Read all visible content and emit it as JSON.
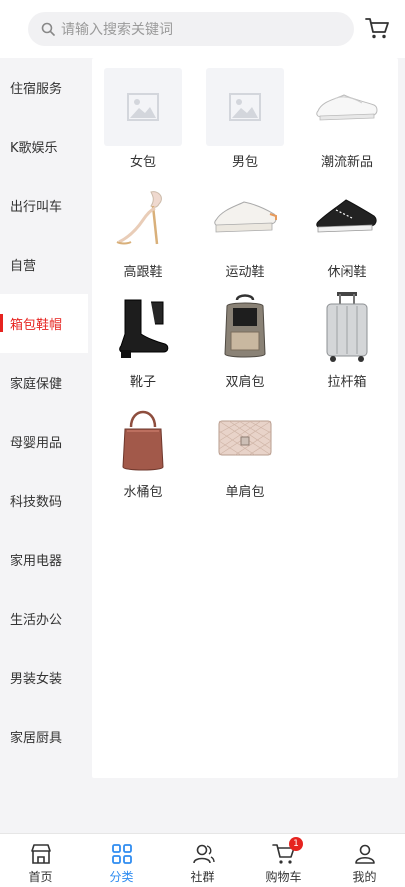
{
  "search": {
    "placeholder": "请输入搜索关键词"
  },
  "sidebar": {
    "items": [
      {
        "label": "住宿服务"
      },
      {
        "label": "K歌娱乐"
      },
      {
        "label": "出行叫车"
      },
      {
        "label": "自营"
      },
      {
        "label": "箱包鞋帽",
        "active": true
      },
      {
        "label": "家庭保健"
      },
      {
        "label": "母婴用品"
      },
      {
        "label": "科技数码"
      },
      {
        "label": "家用电器"
      },
      {
        "label": "生活办公"
      },
      {
        "label": "男装女装"
      },
      {
        "label": "家居厨具"
      }
    ]
  },
  "categories": [
    {
      "label": "女包",
      "image": "placeholder-image-icon"
    },
    {
      "label": "男包",
      "image": "placeholder-image-icon"
    },
    {
      "label": "潮流新品",
      "image": "white-sneaker"
    },
    {
      "label": "高跟鞋",
      "image": "high-heel-sandal"
    },
    {
      "label": "运动鞋",
      "image": "white-platform-sneaker"
    },
    {
      "label": "休闲鞋",
      "image": "black-canvas-sneaker"
    },
    {
      "label": "靴子",
      "image": "black-ankle-boot"
    },
    {
      "label": "双肩包",
      "image": "backpack"
    },
    {
      "label": "拉杆箱",
      "image": "silver-suitcase"
    },
    {
      "label": "水桶包",
      "image": "bucket-bag"
    },
    {
      "label": "单肩包",
      "image": "quilted-shoulder-bag"
    }
  ],
  "tabbar": {
    "items": [
      {
        "label": "首页",
        "icon": "store-icon"
      },
      {
        "label": "分类",
        "icon": "grid-icon",
        "active": true
      },
      {
        "label": "社群",
        "icon": "community-icon"
      },
      {
        "label": "购物车",
        "icon": "cart-icon",
        "badge": "1"
      },
      {
        "label": "我的",
        "icon": "user-icon"
      }
    ]
  },
  "colors": {
    "accent_red": "#e6231f",
    "active_blue": "#2f8cf0"
  }
}
